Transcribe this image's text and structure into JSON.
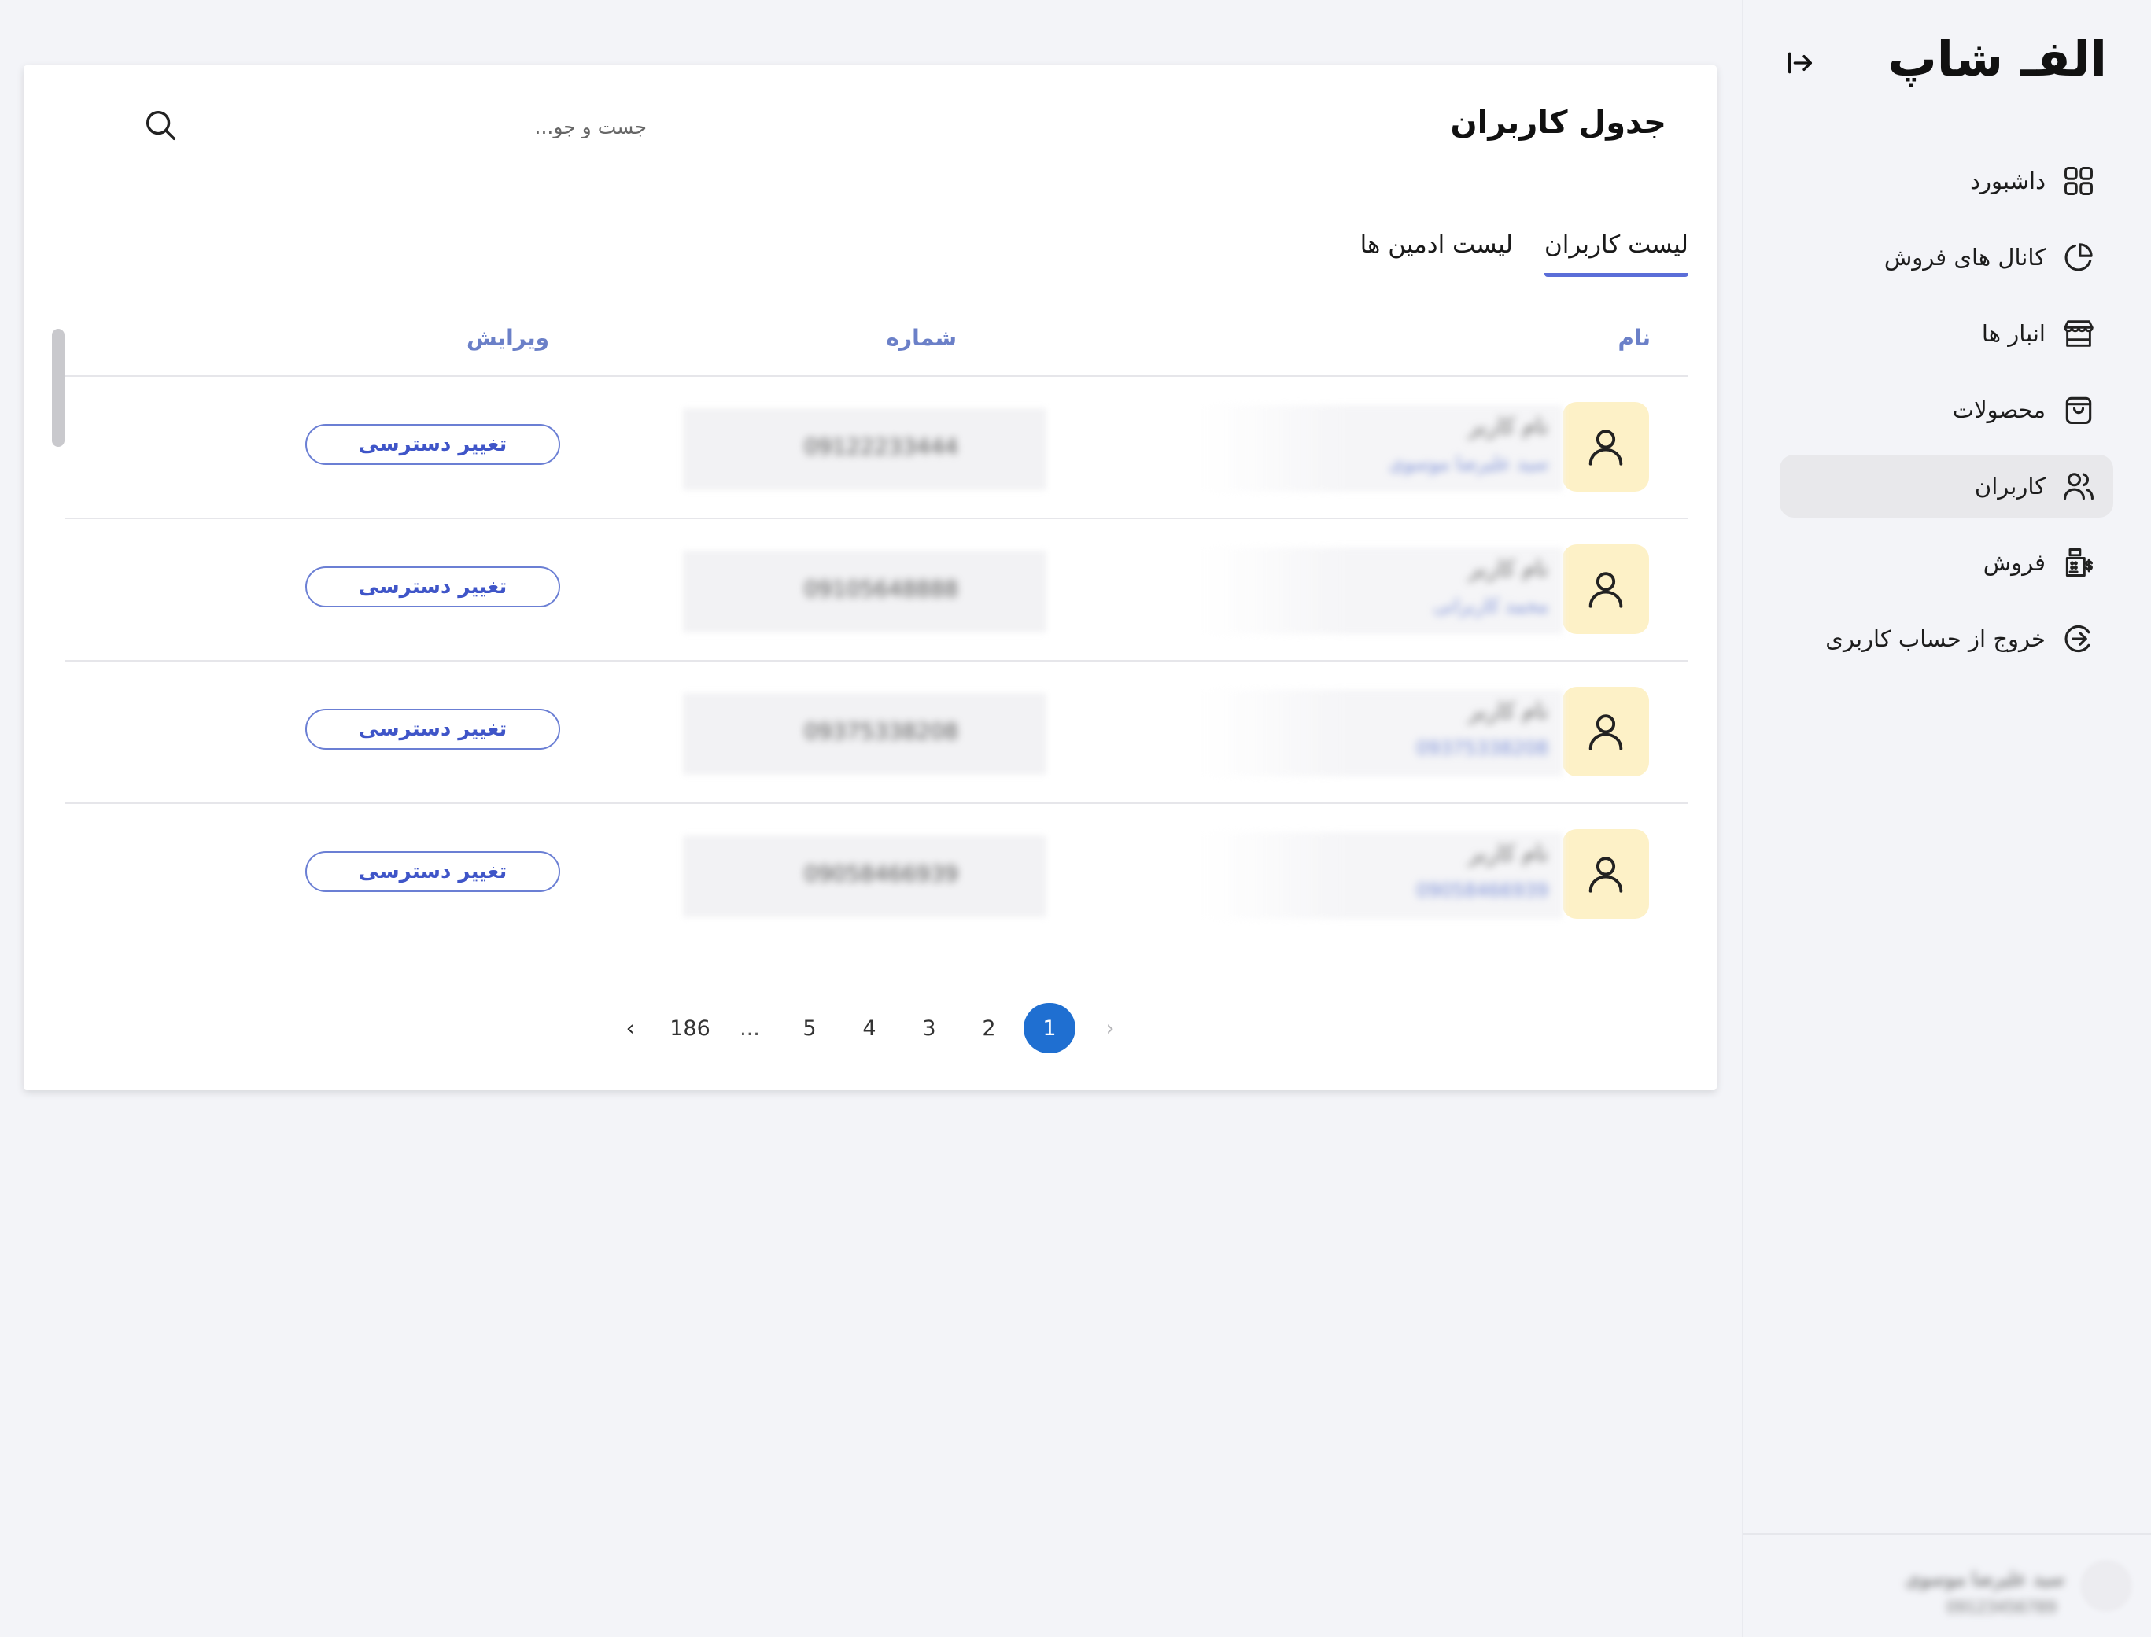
{
  "app": {
    "logo": "الفـ شاپ"
  },
  "sidebar": {
    "items": [
      {
        "label": "داشبورد",
        "icon": "grid-icon"
      },
      {
        "label": "کانال های فروش",
        "icon": "pie-chart-icon"
      },
      {
        "label": "انبار ها",
        "icon": "store-icon"
      },
      {
        "label": "محصولات",
        "icon": "shopping-bag-icon"
      },
      {
        "label": "کاربران",
        "icon": "users-icon",
        "active": true
      },
      {
        "label": "فروش",
        "icon": "sales-register-icon"
      },
      {
        "label": "خروج از حساب کاربری",
        "icon": "logout-icon"
      }
    ],
    "footer": {
      "name": "سید علیرضا موسوی",
      "sub": "09123456789"
    }
  },
  "page": {
    "title": "جدول کاربران",
    "search": {
      "placeholder": "جست و جو...",
      "value": ""
    },
    "tabs": [
      {
        "label": "لیست کاربران",
        "active": true
      },
      {
        "label": "لیست ادمین ها",
        "active": false
      }
    ],
    "columns": {
      "name": "نام",
      "number": "شماره",
      "edit": "ویرایش"
    },
    "rows": [
      {
        "name": "نام کاربر",
        "sub": "سید علیرضا موسوی",
        "number": "09122233444",
        "action": "تغییر دسترسی"
      },
      {
        "name": "نام کاربر",
        "sub": "محمد کاربرانی",
        "number": "09105648888",
        "action": "تغییر دسترسی"
      },
      {
        "name": "نام کاربر",
        "sub": "09375338208",
        "number": "09375338208",
        "action": "تغییر دسترسی"
      },
      {
        "name": "نام کاربر",
        "sub": "09058466939",
        "number": "09058466939",
        "action": "تغییر دسترسی"
      }
    ],
    "pagination": {
      "prev": "‹",
      "next": "›",
      "pages": [
        "1",
        "2",
        "3",
        "4",
        "5"
      ],
      "ellipsis": "...",
      "last": "186",
      "current": "1"
    }
  },
  "colors": {
    "accent": "#1f6fd1",
    "tab_underline": "#5b6ed8",
    "header_text": "#6b80c8",
    "avatar_bg": "#fdf1c7",
    "button_border": "#6b7fd4"
  }
}
